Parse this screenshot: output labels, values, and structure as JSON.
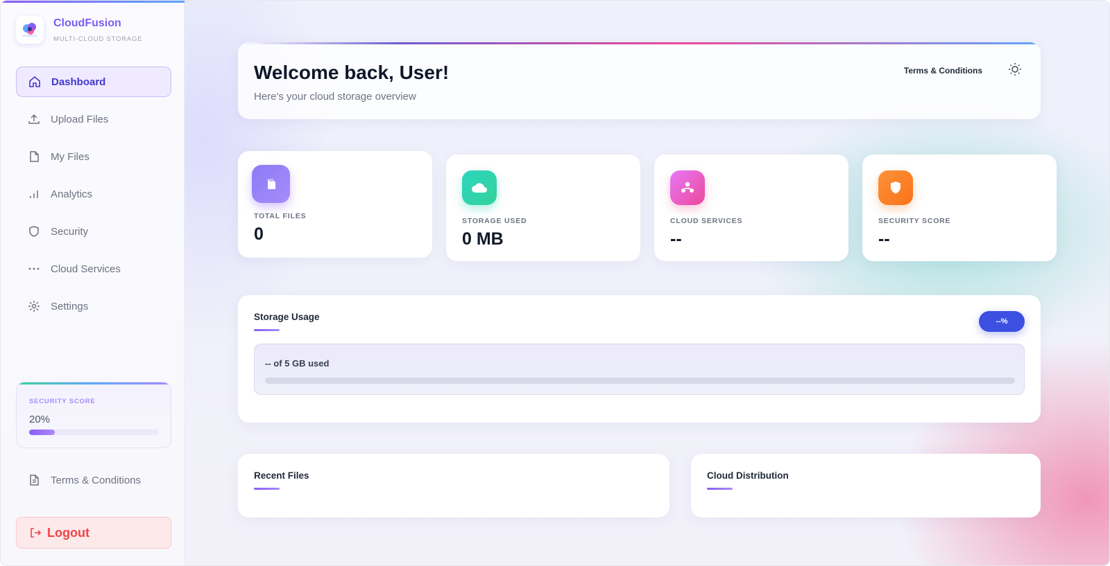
{
  "brand": {
    "name": "CloudFusion",
    "tagline": "MULTI-CLOUD STORAGE",
    "logo_text": "CloudFusion"
  },
  "sidebar": {
    "items": [
      {
        "label": "Dashboard",
        "icon": "home-icon",
        "active": true
      },
      {
        "label": "Upload Files",
        "icon": "upload-icon",
        "active": false
      },
      {
        "label": "My Files",
        "icon": "file-icon",
        "active": false
      },
      {
        "label": "Analytics",
        "icon": "bar-chart-icon",
        "active": false
      },
      {
        "label": "Security",
        "icon": "shield-icon",
        "active": false
      },
      {
        "label": "Cloud Services",
        "icon": "more-dots-icon",
        "active": false
      },
      {
        "label": "Settings",
        "icon": "gear-icon",
        "active": false
      }
    ],
    "security": {
      "title": "SECURITY SCORE",
      "value": "20%",
      "fraction": 0.2
    },
    "terms_label": "Terms & Conditions",
    "logout_label": "Logout"
  },
  "header": {
    "title": "Welcome back, User!",
    "subtitle": "Here's your cloud storage overview",
    "terms_label": "Terms & Conditions",
    "theme_icon": "sun-icon"
  },
  "stats": [
    {
      "label": "TOTAL FILES",
      "value": "0",
      "icon": "file-icon",
      "color": "#8b7cf6"
    },
    {
      "label": "STORAGE USED",
      "value": "0 MB",
      "icon": "cloud-icon",
      "color": "#2dd4bf"
    },
    {
      "label": "CLOUD SERVICES",
      "value": "--",
      "icon": "network-icon",
      "color": "#ec4899"
    },
    {
      "label": "SECURITY SCORE",
      "value": "--",
      "icon": "shield-icon",
      "color": "#f97316"
    }
  ],
  "usage": {
    "title": "Storage Usage",
    "percent_label": "--%",
    "used_text": "-- of 5 GB used",
    "fill_fraction": 0
  },
  "recent": {
    "title": "Recent Files"
  },
  "distribution": {
    "title": "Cloud Distribution"
  },
  "colors": {
    "accent": "#8b5cf6",
    "primary_button": "#3b4fe0",
    "logout": "#ef4444"
  }
}
